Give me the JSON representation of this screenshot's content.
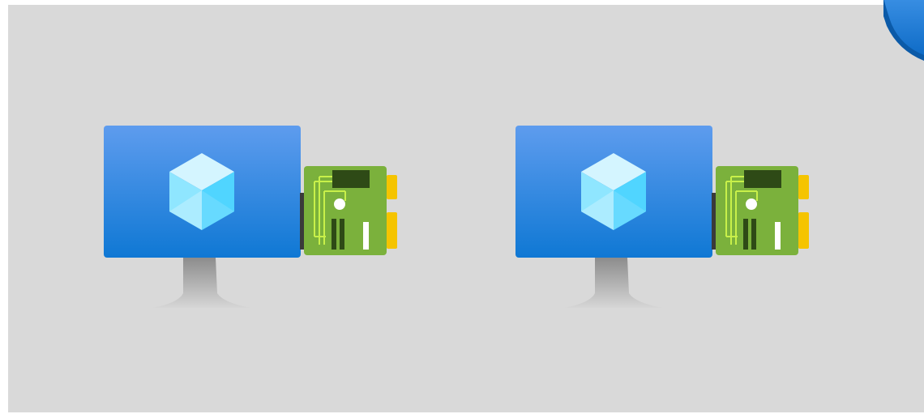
{
  "diagram": {
    "background_color": "#ffffff",
    "panel_color": "#d9d9d9",
    "nodes": [
      {
        "id": "vm-1",
        "icon": "virtual-machine-icon",
        "attachment": "network-interface-card-icon"
      },
      {
        "id": "vm-2",
        "icon": "virtual-machine-icon",
        "attachment": "network-interface-card-icon"
      }
    ],
    "edge_icon": "shield-icon",
    "colors": {
      "monitor_top": "#5e9cee",
      "monitor_bottom": "#0f78d4",
      "stand": "#b5b5b5",
      "cube_light": "#d4f5ff",
      "cube_mid": "#8fe6ff",
      "cube_dark": "#50d5ff",
      "nic_board": "#7bb13c",
      "nic_trace": "#c8f04a",
      "nic_chip": "#2e4a16",
      "nic_pins": "#f5c400",
      "connector": "#3a3a3a"
    }
  }
}
